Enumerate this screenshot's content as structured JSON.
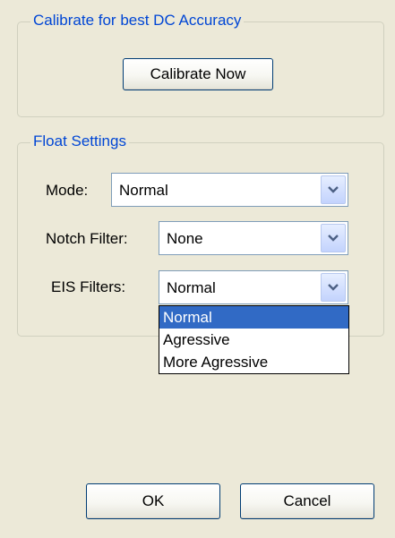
{
  "calibrate_group": {
    "title": "Calibrate for best DC Accuracy",
    "button_label": "Calibrate Now"
  },
  "float_group": {
    "title": "Float Settings",
    "mode": {
      "label": "Mode:",
      "value": "Normal"
    },
    "notch_filter": {
      "label": "Notch Filter:",
      "value": "None"
    },
    "eis_filters": {
      "label": "EIS Filters:",
      "value": "Normal",
      "options": [
        "Normal",
        "Agressive",
        "More Agressive"
      ],
      "highlighted_option": "Normal"
    }
  },
  "footer": {
    "ok_label": "OK",
    "cancel_label": "Cancel"
  },
  "icons": {
    "combo_arrow": "chevron-down-icon"
  }
}
